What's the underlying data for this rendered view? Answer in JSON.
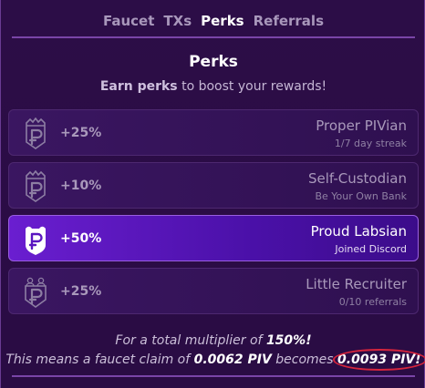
{
  "nav": {
    "items": [
      {
        "label": "Faucet",
        "active": false
      },
      {
        "label": "TXs",
        "active": false
      },
      {
        "label": "Perks",
        "active": true
      },
      {
        "label": "Referrals",
        "active": false
      }
    ]
  },
  "header": {
    "title": "Perks",
    "subtitle_bold": "Earn perks",
    "subtitle_rest": " to boost your rewards!"
  },
  "perks": [
    {
      "boost": "+25%",
      "name": "Proper PIVian",
      "desc": "1/7 day streak",
      "active": false,
      "icon": "pivx-crown-badge-icon"
    },
    {
      "boost": "+10%",
      "name": "Self-Custodian",
      "desc": "Be Your Own Bank",
      "active": false,
      "icon": "pivx-crown-badge-icon"
    },
    {
      "boost": "+50%",
      "name": "Proud Labsian",
      "desc": "Joined Discord",
      "active": true,
      "icon": "pivx-discord-badge-icon"
    },
    {
      "boost": "+25%",
      "name": "Little Recruiter",
      "desc": "0/10 referrals",
      "active": false,
      "icon": "pivx-people-badge-icon"
    }
  ],
  "summary": {
    "line1_prefix": "For a total multiplier of ",
    "line1_value": "150%!",
    "line2_prefix": "This means a faucet claim of ",
    "line2_claim": "0.0062 PIV",
    "line2_middle": " becomes ",
    "line2_result": "0.0093 PIV!"
  },
  "colors": {
    "background": "#2a0c44",
    "active_perk": "#6a1ed0",
    "divider": "#7a45a8",
    "annotation_circle": "#d6253d"
  }
}
